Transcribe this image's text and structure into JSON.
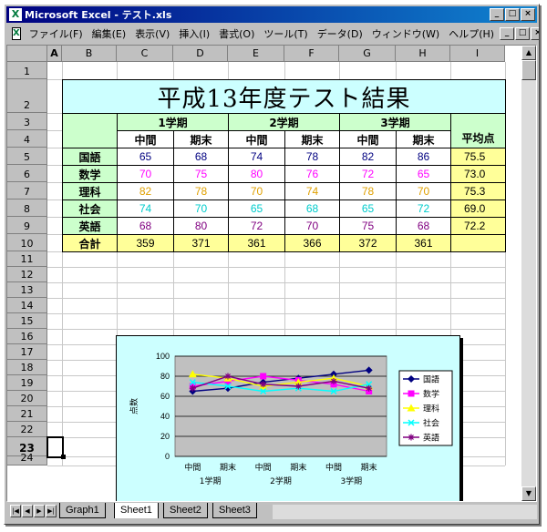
{
  "window": {
    "title": "Microsoft Excel - テスト.xls",
    "app_icon": "X",
    "controls": [
      "_",
      "□",
      "×"
    ]
  },
  "menu": {
    "items": [
      "ファイル(F)",
      "編集(E)",
      "表示(V)",
      "挿入(I)",
      "書式(O)",
      "ツール(T)",
      "データ(D)",
      "ウィンドウ(W)",
      "ヘルプ(H)"
    ],
    "doc_controls": [
      "_",
      "□",
      "×"
    ]
  },
  "grid": {
    "columns": [
      "A",
      "B",
      "C",
      "D",
      "E",
      "F",
      "G",
      "H",
      "I"
    ],
    "selected_column": "A",
    "rows": [
      "1",
      "2",
      "3",
      "4",
      "5",
      "6",
      "7",
      "8",
      "9",
      "10",
      "11",
      "12",
      "13",
      "14",
      "15",
      "16",
      "17",
      "18",
      "19",
      "20",
      "21",
      "22",
      "23",
      "24"
    ],
    "selected_row": "23"
  },
  "sheet": {
    "title": "平成13年度テスト結果",
    "terms": [
      "1学期",
      "2学期",
      "3学期"
    ],
    "exam_types": [
      "中間",
      "期末",
      "中間",
      "期末",
      "中間",
      "期末"
    ],
    "avg_header": "平均点",
    "subjects": [
      {
        "name": "国語",
        "scores": [
          "65",
          "68",
          "74",
          "78",
          "82",
          "86"
        ],
        "avg": "75.5",
        "color": "#000080"
      },
      {
        "name": "数学",
        "scores": [
          "70",
          "75",
          "80",
          "76",
          "72",
          "65"
        ],
        "avg": "73.0",
        "color": "#ff00ff"
      },
      {
        "name": "理科",
        "scores": [
          "82",
          "78",
          "70",
          "74",
          "78",
          "70"
        ],
        "avg": "75.3",
        "color": "#e0a000"
      },
      {
        "name": "社会",
        "scores": [
          "74",
          "70",
          "65",
          "68",
          "65",
          "72"
        ],
        "avg": "69.0",
        "color": "#00cccc"
      },
      {
        "name": "英語",
        "scores": [
          "68",
          "80",
          "72",
          "70",
          "75",
          "68"
        ],
        "avg": "72.2",
        "color": "#800080"
      }
    ],
    "total": {
      "label": "合計",
      "values": [
        "359",
        "371",
        "361",
        "366",
        "372",
        "361"
      ]
    }
  },
  "chart_data": {
    "type": "line",
    "categories": [
      "中間",
      "期末",
      "中間",
      "期末",
      "中間",
      "期末"
    ],
    "category_groups": [
      "1学期",
      "2学期",
      "3学期"
    ],
    "ylabel": "点数",
    "ylim": [
      0,
      100
    ],
    "yticks": [
      "0",
      "20",
      "40",
      "60",
      "80",
      "100"
    ],
    "grid": true,
    "legend": "right",
    "series": [
      {
        "name": "国語",
        "values": [
          65,
          68,
          74,
          78,
          82,
          86
        ],
        "color": "#000080",
        "marker": "diamond"
      },
      {
        "name": "数学",
        "values": [
          70,
          75,
          80,
          76,
          72,
          65
        ],
        "color": "#ff00ff",
        "marker": "square"
      },
      {
        "name": "理科",
        "values": [
          82,
          78,
          70,
          74,
          78,
          70
        ],
        "color": "#ffff00",
        "marker": "triangle"
      },
      {
        "name": "社会",
        "values": [
          74,
          70,
          65,
          68,
          65,
          72
        ],
        "color": "#00ffff",
        "marker": "x"
      },
      {
        "name": "英語",
        "values": [
          68,
          80,
          72,
          70,
          75,
          68
        ],
        "color": "#800080",
        "marker": "star"
      }
    ]
  },
  "tabs": {
    "nav": [
      "|◀",
      "◀",
      "▶",
      "▶|"
    ],
    "items": [
      "Graph1",
      "Sheet1",
      "Sheet2",
      "Sheet3"
    ],
    "active": "Sheet1"
  }
}
